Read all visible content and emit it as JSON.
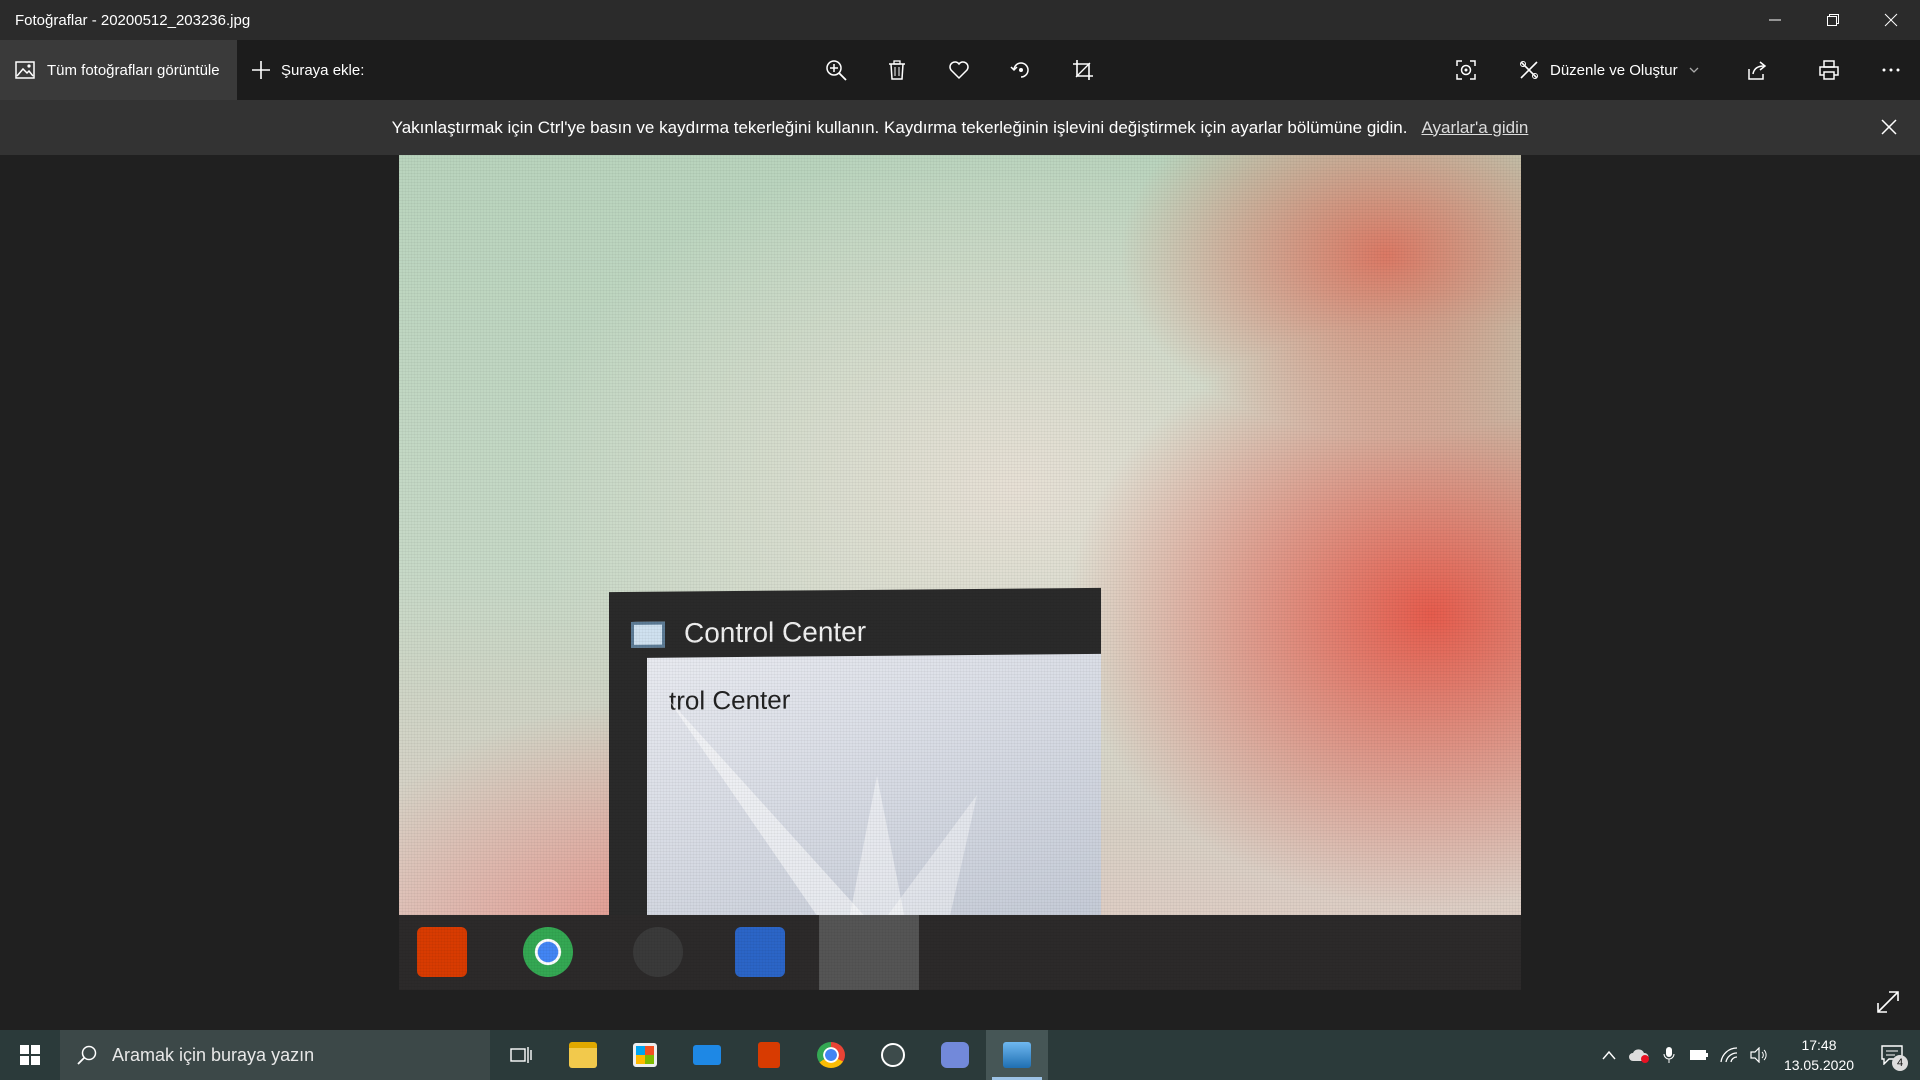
{
  "window": {
    "title": "Fotoğraflar - 20200512_203236.jpg",
    "controls": [
      "minimize-icon",
      "restore-icon",
      "close-icon"
    ]
  },
  "toolbar": {
    "view_all_label": "Tüm fotoğrafları görüntüle",
    "add_to_label": "Şuraya ekle:",
    "center_icons": [
      "zoom-in-icon",
      "delete-icon",
      "favorite-icon",
      "rotate-icon",
      "crop-icon"
    ],
    "edit_create_label": "Düzenle ve Oluştur",
    "right_icons": [
      "visual-search-icon",
      "share-icon",
      "print-icon",
      "more-icon"
    ]
  },
  "notice": {
    "text": "Yakınlaştırmak için Ctrl'ye basın ve kaydırma tekerleğini kullanın. Kaydırma tekerleğinin işlevini değiştirmek için ayarlar bölümüne gidin.",
    "link": "Ayarlar'a gidin"
  },
  "photo": {
    "popup_title": "Control Center",
    "preview_text": "trol Center",
    "taskbar_apps": [
      "office-icon",
      "chrome-icon",
      "whatsapp-icon",
      "word-icon",
      "control-center-icon"
    ]
  },
  "taskbar": {
    "search_placeholder": "Aramak için buraya yazın",
    "apps": [
      "task-view-icon",
      "file-explorer-icon",
      "store-icon",
      "mail-icon",
      "office-icon",
      "chrome-icon",
      "whatsapp-icon",
      "discord-icon",
      "photos-icon"
    ],
    "time": "17:48",
    "date": "13.05.2020",
    "notification_count": "4"
  },
  "colors": {
    "titlebar": "#2b2b2b",
    "toolbar": "#1c1c1c",
    "notice": "#333333",
    "taskbar": "#2b3a3a",
    "accent": "#9dc3e6"
  }
}
